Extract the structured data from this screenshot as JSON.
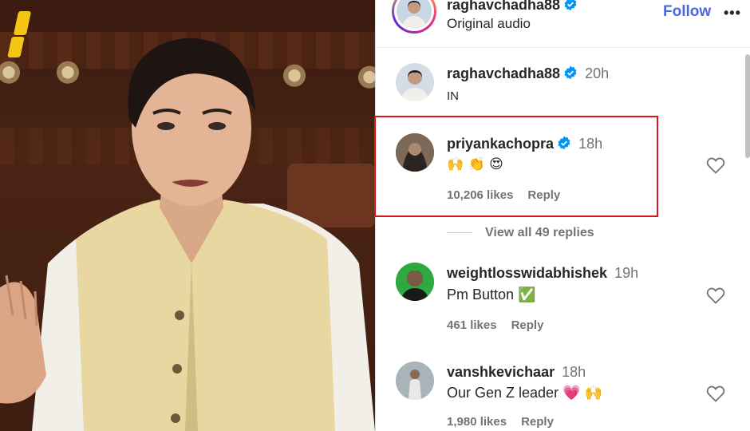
{
  "header": {
    "username": "raghavchadha88",
    "subtitle": "Original audio",
    "follow_label": "Follow",
    "more_label": "•••"
  },
  "caption": {
    "username": "raghavchadha88",
    "time": "20h",
    "text": "IN"
  },
  "comments": [
    {
      "username": "priyankachopra",
      "verified": true,
      "time": "18h",
      "text": "🙌 👏 😍",
      "likes": "10,206 likes",
      "reply": "Reply"
    },
    {
      "username": "weightlosswidabhishek",
      "verified": false,
      "time": "19h",
      "text": "Pm Button ✅",
      "likes": "461 likes",
      "reply": "Reply"
    },
    {
      "username": "vanshkevichaar",
      "verified": false,
      "time": "18h",
      "text": "Our Gen Z leader 💗 🙌",
      "likes": "1,980 likes",
      "reply": "Reply"
    }
  ],
  "view_replies": "View all 49 replies",
  "colors": {
    "follow_blue": "#4a67e0",
    "verified_blue": "#0095f6",
    "highlight_red": "#e0131a",
    "logo_yellow": "#f5c515"
  }
}
